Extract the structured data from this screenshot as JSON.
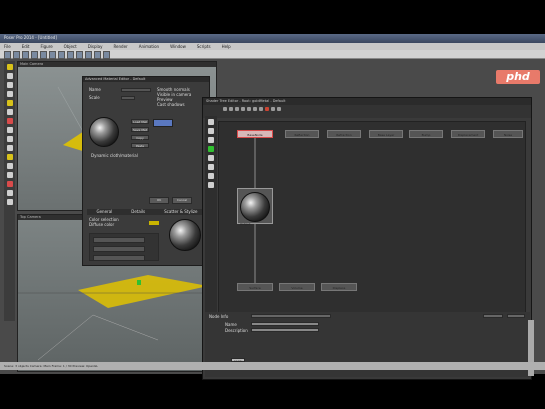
{
  "window": {
    "title": "Poser Pro 2014 - [Untitled]"
  },
  "menu": [
    "File",
    "Edit",
    "Figure",
    "Object",
    "Display",
    "Render",
    "Animation",
    "Window",
    "Scripts",
    "Help"
  ],
  "viewport1": {
    "label": "Main Camera"
  },
  "viewport2": {
    "label": "Top Camera"
  },
  "material_dialog": {
    "title": "Advanced Material Editor - Default",
    "name_label": "Name",
    "name_value": "Default",
    "scale_label": "Scale",
    "scale_value": "1.0",
    "options": [
      "Smooth normals",
      "Visible in camera",
      "Preview",
      "Cast shadows"
    ],
    "buttons": [
      "Load Mat",
      "Save Mat",
      "Copy",
      "Paste"
    ],
    "link_label": "Dynamic cloth/material",
    "tabs": [
      "General",
      "Details",
      "Scatter & Stylize"
    ],
    "section_title": "Color selection",
    "section_sub": "Diffuse color",
    "apply_label": "Apply",
    "ok_label": "OK",
    "cancel_label": "Cancel"
  },
  "shader_tree": {
    "title": "Shader Tree Editor - Root: goldMetal - Default",
    "nodes": [
      "BaseNode",
      "Reflection",
      "Refraction",
      "Base Layer",
      "Bump",
      "Displacement",
      "Noise"
    ],
    "output_node": "Output",
    "bottom_nodes": [
      "Surface",
      "Volume",
      "Displace"
    ],
    "props": {
      "title_label": "Node Info",
      "name_label": "Name",
      "desc_label": "Description",
      "extra_label": "Key"
    }
  },
  "statusbar": {
    "text": "Scene: 3 objects   Camera: Main   Frame: 1 / 30   Preview: OpenGL"
  },
  "logo": {
    "text": "phd"
  },
  "colors": {
    "accent": "#e87a6a",
    "highlight": "#d94b4b"
  }
}
